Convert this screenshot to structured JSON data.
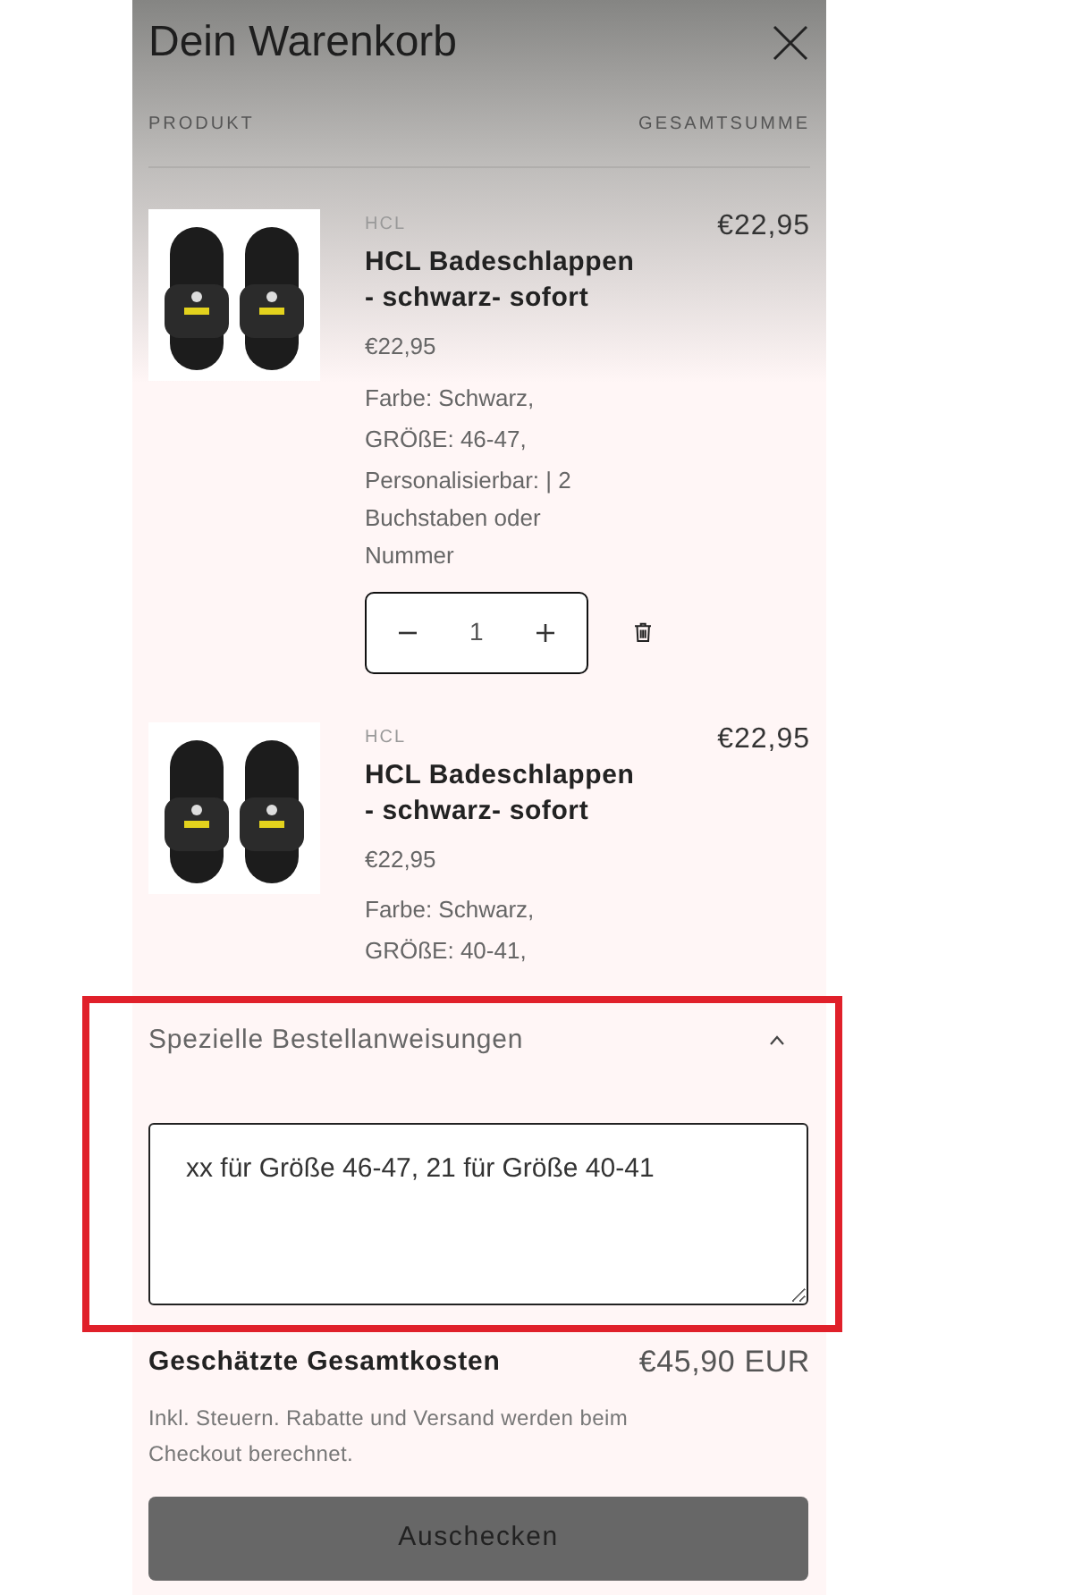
{
  "header": {
    "title": "Dein Warenkorb"
  },
  "columns": [
    "PRODUKT",
    "GESAMTSUMME"
  ],
  "items": [
    {
      "brand": "HCL",
      "name": "HCL Badeschlappen - schwarz- sofort",
      "unit_price": "€22,95",
      "options": [
        "Farbe: Schwarz,",
        "GRÖßE: 46-47,",
        "Personalisierbar: | 2 Buchstaben oder Nummer"
      ],
      "quantity": "1",
      "total": "€22,95"
    },
    {
      "brand": "HCL",
      "name": "HCL Badeschlappen - schwarz- sofort",
      "unit_price": "€22,95",
      "options": [
        "Farbe: Schwarz,",
        "GRÖßE: 40-41,"
      ],
      "total": "€22,95"
    }
  ],
  "instructions": {
    "label": "Spezielle Bestellanweisungen",
    "expanded": true,
    "value": "xx für Größe 46-47, 21 für Größe 40-41"
  },
  "totals": {
    "label": "Geschätzte Gesamtkosten",
    "value": "€45,90 EUR",
    "note": "Inkl. Steuern. Rabatte und Versand werden beim Checkout berechnet."
  },
  "checkout_button": "Auschecken"
}
